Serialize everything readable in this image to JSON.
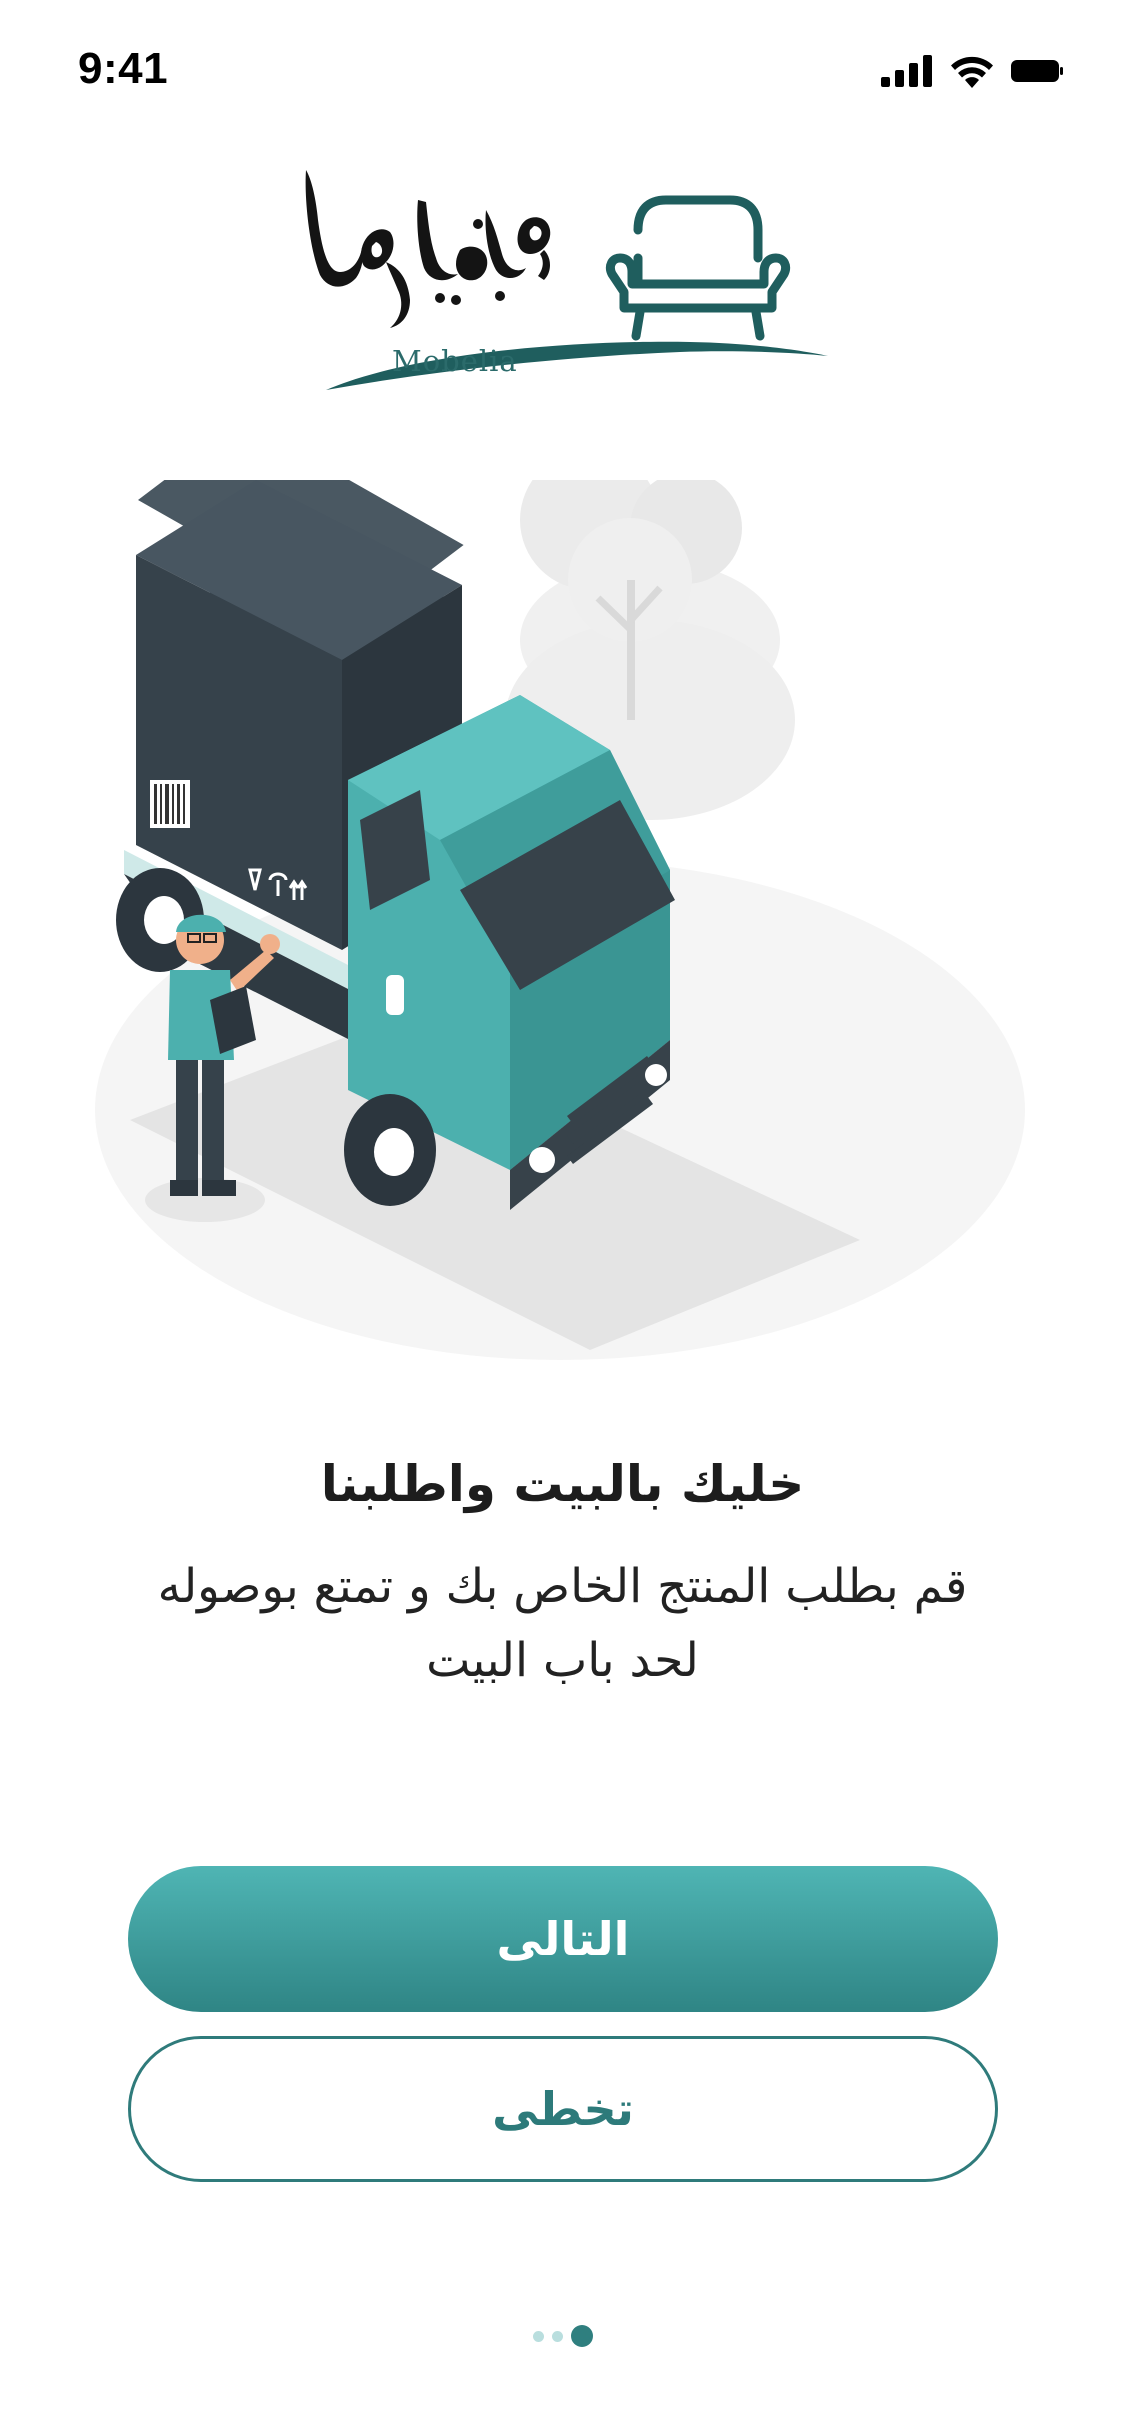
{
  "status_bar": {
    "time": "9:41",
    "icons": [
      "cellular-signal-icon",
      "wifi-icon",
      "battery-icon"
    ]
  },
  "logo": {
    "arabic_name": "موبليا",
    "latin_name": "Mobelia",
    "icon": "armchair-icon"
  },
  "illustration": {
    "icon": "delivery-truck-illustration"
  },
  "onboarding": {
    "title": "خليك بالبيت واطلبنا",
    "description_line_1": "قم بطلب المنتج الخاص بك و تمتع بوصوله",
    "description_line_2": "لحد باب البيت"
  },
  "actions": {
    "next_label": "التالى",
    "skip_label": "تخطى"
  },
  "pagination": {
    "total_pages": 3,
    "current_page": 3
  },
  "colors": {
    "brand": "#2f7f7f",
    "brand_light": "#4fb5b4",
    "dark_text": "#1d1d1d"
  }
}
